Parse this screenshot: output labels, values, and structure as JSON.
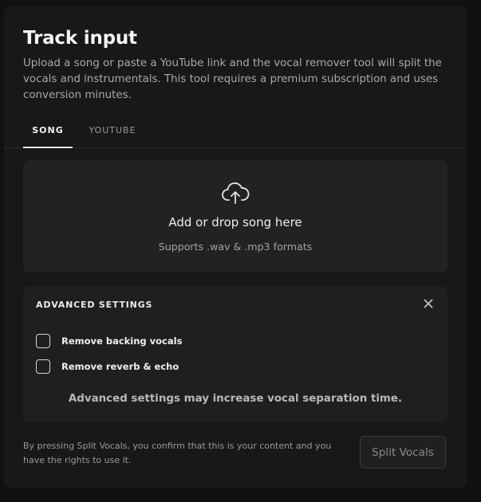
{
  "panel": {
    "title": "Track input",
    "description": "Upload a song or paste a YouTube link and the vocal remover tool will split the vocals and instrumentals. This tool requires a premium subscription and uses conversion minutes."
  },
  "tabs": [
    {
      "label": "SONG",
      "active": true
    },
    {
      "label": "YOUTUBE",
      "active": false
    }
  ],
  "dropzone": {
    "icon": "cloud-upload-icon",
    "title": "Add or drop song here",
    "subtitle": "Supports .wav & .mp3 formats"
  },
  "advanced_settings": {
    "title": "ADVANCED SETTINGS",
    "close_icon": "close-icon",
    "options": [
      {
        "label": "Remove backing vocals",
        "checked": false
      },
      {
        "label": "Remove reverb & echo",
        "checked": false
      }
    ],
    "note": "Advanced settings may increase vocal separation time."
  },
  "footer": {
    "disclaimer": "By pressing Split Vocals, you confirm that this is your content and you have the rights to use it.",
    "split_button_label": "Split Vocals"
  },
  "colors": {
    "background": "#101010",
    "panel": "#181818",
    "card": "#222222",
    "text_primary": "#f0f0f0",
    "text_muted": "#a9a9a9"
  }
}
